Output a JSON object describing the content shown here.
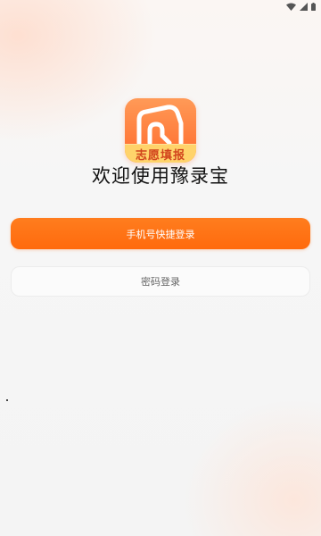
{
  "status_bar": {
    "icons": [
      "wifi-icon",
      "signal-icon",
      "battery-icon"
    ]
  },
  "logo": {
    "icon": "house-icon",
    "band_text": "志愿填报",
    "colors": {
      "gradient_top": "#ff9a57",
      "gradient_bottom": "#ff6a2c",
      "band": "#ffd36a",
      "band_text": "#d2451d"
    }
  },
  "welcome_text": "欢迎使用豫录宝",
  "buttons": {
    "phone_login": "手机号快捷登录",
    "password_login": "密码登录"
  },
  "colors": {
    "accent": "#ff6a0d"
  }
}
